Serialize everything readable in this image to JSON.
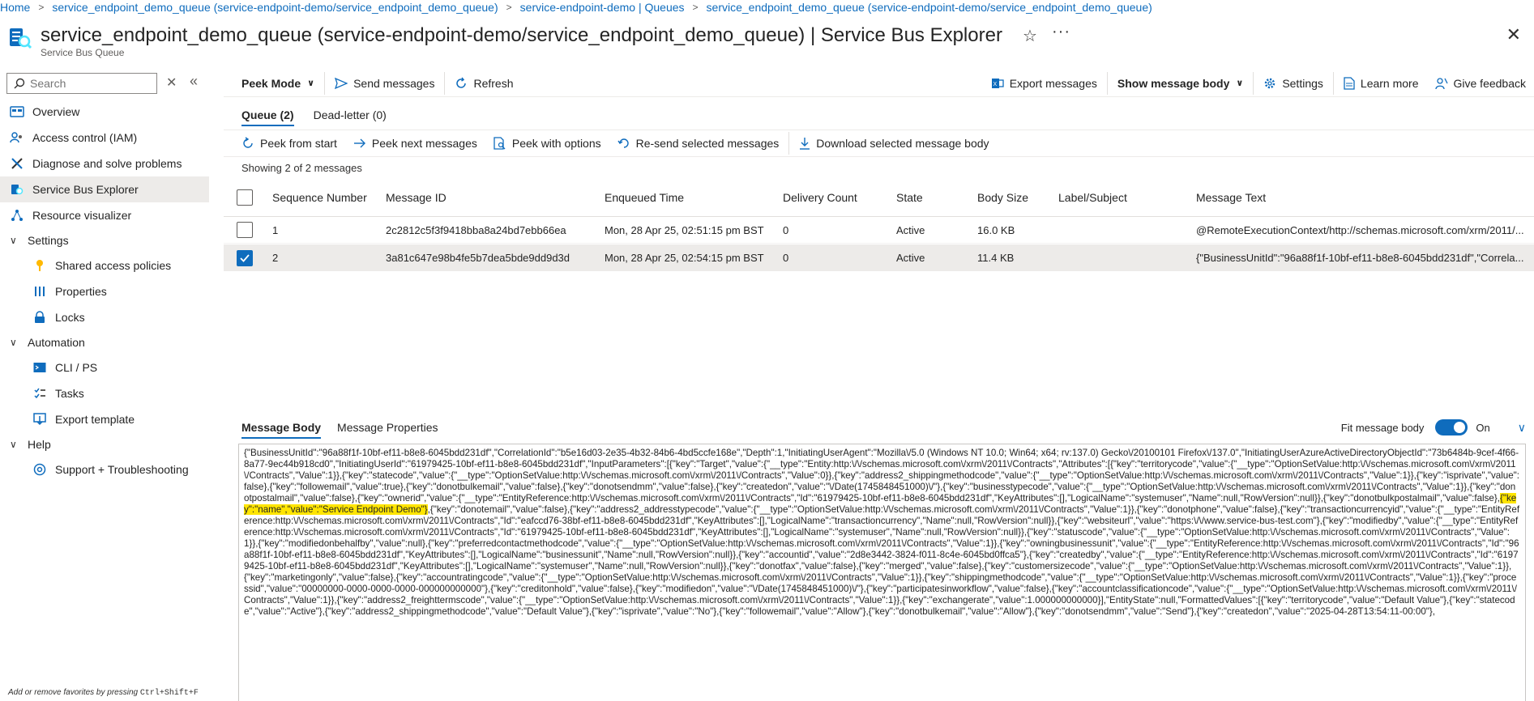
{
  "breadcrumb": [
    "Home",
    "service_endpoint_demo_queue (service-endpoint-demo/service_endpoint_demo_queue)",
    "service-endpoint-demo | Queues",
    "service_endpoint_demo_queue (service-endpoint-demo/service_endpoint_demo_queue)"
  ],
  "header": {
    "title": "service_endpoint_demo_queue (service-endpoint-demo/service_endpoint_demo_queue) | Service Bus Explorer",
    "subtitle": "Service Bus Queue"
  },
  "sidebar": {
    "search_placeholder": "Search",
    "items": [
      {
        "label": "Overview",
        "icon": "overview-icon"
      },
      {
        "label": "Access control (IAM)",
        "icon": "people-icon"
      },
      {
        "label": "Diagnose and solve problems",
        "icon": "wrench-icon"
      },
      {
        "label": "Service Bus Explorer",
        "icon": "explorer-icon"
      },
      {
        "label": "Resource visualizer",
        "icon": "graph-icon"
      }
    ],
    "groups": [
      {
        "label": "Settings",
        "items": [
          "Shared access policies",
          "Properties",
          "Locks"
        ]
      },
      {
        "label": "Automation",
        "items": [
          "CLI / PS",
          "Tasks",
          "Export template"
        ]
      },
      {
        "label": "Help",
        "items": [
          "Support + Troubleshooting"
        ]
      }
    ],
    "fav_hint_prefix": "Add or remove favorites by pressing ",
    "fav_hint_keys": "Ctrl+Shift+F"
  },
  "toolbar": {
    "peek_mode": "Peek Mode",
    "send_messages": "Send messages",
    "refresh": "Refresh",
    "export_messages": "Export messages",
    "show_message_body": "Show message body",
    "settings": "Settings",
    "learn_more": "Learn more",
    "give_feedback": "Give feedback"
  },
  "queue_tabs": {
    "queue": "Queue (2)",
    "dead_letter": "Dead-letter (0)"
  },
  "toolbar2": {
    "peek_from_start": "Peek from start",
    "peek_next": "Peek next messages",
    "peek_with_options": "Peek with options",
    "resend": "Re-send selected messages",
    "download": "Download selected message body"
  },
  "showing": "Showing 2 of 2 messages",
  "grid": {
    "columns": [
      "Sequence Number",
      "Message ID",
      "Enqueued Time",
      "Delivery Count",
      "State",
      "Body Size",
      "Label/Subject",
      "Message Text"
    ],
    "rows": [
      {
        "seq": "1",
        "id": "2c2812c5f3f9418bba8a24bd7ebb66ea",
        "time": "Mon, 28 Apr 25, 02:51:15 pm BST",
        "count": "0",
        "state": "Active",
        "size": "16.0 KB",
        "label": "",
        "text": "@RemoteExecutionContext/http://schemas.microsoft.com/xrm/2011/...",
        "checked": false
      },
      {
        "seq": "2",
        "id": "3a81c647e98b4fe5b7dea5bde9dd9d3d",
        "time": "Mon, 28 Apr 25, 02:54:15 pm BST",
        "count": "0",
        "state": "Active",
        "size": "11.4 KB",
        "label": "",
        "text": "{\"BusinessUnitId\":\"96a88f1f-10bf-ef11-b8e8-6045bdd231df\",\"Correla...",
        "checked": true
      }
    ]
  },
  "lower_tabs": {
    "body": "Message Body",
    "props": "Message Properties"
  },
  "fit": {
    "label": "Fit message body",
    "state": "On"
  },
  "body": {
    "before": "{\"BusinessUnitId\":\"96a88f1f-10bf-ef11-b8e8-6045bdd231df\",\"CorrelationId\":\"b5e16d03-2e35-4b32-84b6-4bd5ccfe168e\",\"Depth\":1,\"InitiatingUserAgent\":\"Mozilla\\/5.0 (Windows NT 10.0; Win64; x64; rv:137.0) Gecko\\/20100101 Firefox\\/137.0\",\"InitiatingUserAzureActiveDirectoryObjectId\":\"73b6484b-9cef-4f66-8a77-9ec44b918cd0\",\"InitiatingUserId\":\"61979425-10bf-ef11-b8e8-6045bdd231df\",\"InputParameters\":[{\"key\":\"Target\",\"value\":{\"__type\":\"Entity:http:\\/\\/schemas.microsoft.com\\/xrm\\/2011\\/Contracts\",\"Attributes\":[{\"key\":\"territorycode\",\"value\":{\"__type\":\"OptionSetValue:http:\\/\\/schemas.microsoft.com\\/xrm\\/2011\\/Contracts\",\"Value\":1}},{\"key\":\"statecode\",\"value\":{\"__type\":\"OptionSetValue:http:\\/\\/schemas.microsoft.com\\/xrm\\/2011\\/Contracts\",\"Value\":0}},{\"key\":\"address2_shippingmethodcode\",\"value\":{\"__type\":\"OptionSetValue:http:\\/\\/schemas.microsoft.com\\/xrm\\/2011\\/Contracts\",\"Value\":1}},{\"key\":\"isprivate\",\"value\":false},{\"key\":\"followemail\",\"value\":true},{\"key\":\"donotbulkemail\",\"value\":false},{\"key\":\"donotsendmm\",\"value\":false},{\"key\":\"createdon\",\"value\":\"\\/Date(1745848451000)\\/\"},{\"key\":\"businesstypecode\",\"value\":{\"__type\":\"OptionSetValue:http:\\/\\/schemas.microsoft.com\\/xrm\\/2011\\/Contracts\",\"Value\":1}},{\"key\":\"donotpostalmail\",\"value\":false},{\"key\":\"ownerid\",\"value\":{\"__type\":\"EntityReference:http:\\/\\/schemas.microsoft.com\\/xrm\\/2011\\/Contracts\",\"Id\":\"61979425-10bf-ef11-b8e8-6045bdd231df\",\"KeyAttributes\":[],\"LogicalName\":\"systemuser\",\"Name\":null,\"RowVersion\":null}},{\"key\":\"donotbulkpostalmail\",\"value\":false},",
    "highlight": "{\"key\":\"name\",\"value\":\"Service Endpoint Demo\"}",
    "after": ",{\"key\":\"donotemail\",\"value\":false},{\"key\":\"address2_addresstypecode\",\"value\":{\"__type\":\"OptionSetValue:http:\\/\\/schemas.microsoft.com\\/xrm\\/2011\\/Contracts\",\"Value\":1}},{\"key\":\"donotphone\",\"value\":false},{\"key\":\"transactioncurrencyid\",\"value\":{\"__type\":\"EntityReference:http:\\/\\/schemas.microsoft.com\\/xrm\\/2011\\/Contracts\",\"Id\":\"eafccd76-38bf-ef11-b8e8-6045bdd231df\",\"KeyAttributes\":[],\"LogicalName\":\"transactioncurrency\",\"Name\":null,\"RowVersion\":null}},{\"key\":\"websiteurl\",\"value\":\"https:\\/\\/www.service-bus-test.com\"},{\"key\":\"modifiedby\",\"value\":{\"__type\":\"EntityReference:http:\\/\\/schemas.microsoft.com\\/xrm\\/2011\\/Contracts\",\"Id\":\"61979425-10bf-ef11-b8e8-6045bdd231df\",\"KeyAttributes\":[],\"LogicalName\":\"systemuser\",\"Name\":null,\"RowVersion\":null}},{\"key\":\"statuscode\",\"value\":{\"__type\":\"OptionSetValue:http:\\/\\/schemas.microsoft.com\\/xrm\\/2011\\/Contracts\",\"Value\":1}},{\"key\":\"modifiedonbehalfby\",\"value\":null},{\"key\":\"preferredcontactmethodcode\",\"value\":{\"__type\":\"OptionSetValue:http:\\/\\/schemas.microsoft.com\\/xrm\\/2011\\/Contracts\",\"Value\":1}},{\"key\":\"owningbusinessunit\",\"value\":{\"__type\":\"EntityReference:http:\\/\\/schemas.microsoft.com\\/xrm\\/2011\\/Contracts\",\"Id\":\"96a88f1f-10bf-ef11-b8e8-6045bdd231df\",\"KeyAttributes\":[],\"LogicalName\":\"businessunit\",\"Name\":null,\"RowVersion\":null}},{\"key\":\"accountid\",\"value\":\"2d8e3442-3824-f011-8c4e-6045bd0ffca5\"},{\"key\":\"createdby\",\"value\":{\"__type\":\"EntityReference:http:\\/\\/schemas.microsoft.com\\/xrm\\/2011\\/Contracts\",\"Id\":\"61979425-10bf-ef11-b8e8-6045bdd231df\",\"KeyAttributes\":[],\"LogicalName\":\"systemuser\",\"Name\":null,\"RowVersion\":null}},{\"key\":\"donotfax\",\"value\":false},{\"key\":\"merged\",\"value\":false},{\"key\":\"customersizecode\",\"value\":{\"__type\":\"OptionSetValue:http:\\/\\/schemas.microsoft.com\\/xrm\\/2011\\/Contracts\",\"Value\":1}},{\"key\":\"marketingonly\",\"value\":false},{\"key\":\"accountratingcode\",\"value\":{\"__type\":\"OptionSetValue:http:\\/\\/schemas.microsoft.com\\/xrm\\/2011\\/Contracts\",\"Value\":1}},{\"key\":\"shippingmethodcode\",\"value\":{\"__type\":\"OptionSetValue:http:\\/\\/schemas.microsoft.com\\/xrm\\/2011\\/Contracts\",\"Value\":1}},{\"key\":\"processid\",\"value\":\"00000000-0000-0000-0000-000000000000\"},{\"key\":\"creditonhold\",\"value\":false},{\"key\":\"modifiedon\",\"value\":\"\\/Date(1745848451000)\\/\"},{\"key\":\"participatesinworkflow\",\"value\":false},{\"key\":\"accountclassificationcode\",\"value\":{\"__type\":\"OptionSetValue:http:\\/\\/schemas.microsoft.com\\/xrm\\/2011\\/Contracts\",\"Value\":1}},{\"key\":\"address2_freighttermscode\",\"value\":{\"__type\":\"OptionSetValue:http:\\/\\/schemas.microsoft.com\\/xrm\\/2011\\/Contracts\",\"Value\":1}},{\"key\":\"exchangerate\",\"value\":1.000000000000}],\"EntityState\":null,\"FormattedValues\":[{\"key\":\"territorycode\",\"value\":\"Default Value\"},{\"key\":\"statecode\",\"value\":\"Active\"},{\"key\":\"address2_shippingmethodcode\",\"value\":\"Default Value\"},{\"key\":\"isprivate\",\"value\":\"No\"},{\"key\":\"followemail\",\"value\":\"Allow\"},{\"key\":\"donotbulkemail\",\"value\":\"Allow\"},{\"key\":\"donotsendmm\",\"value\":\"Send\"},{\"key\":\"createdon\",\"value\":\"2025-04-28T13:54:11-00:00\"},"
  },
  "colors": {
    "accent": "#0f6cbd",
    "highlight": "#ffe500",
    "selected_row": "#edebe9"
  }
}
